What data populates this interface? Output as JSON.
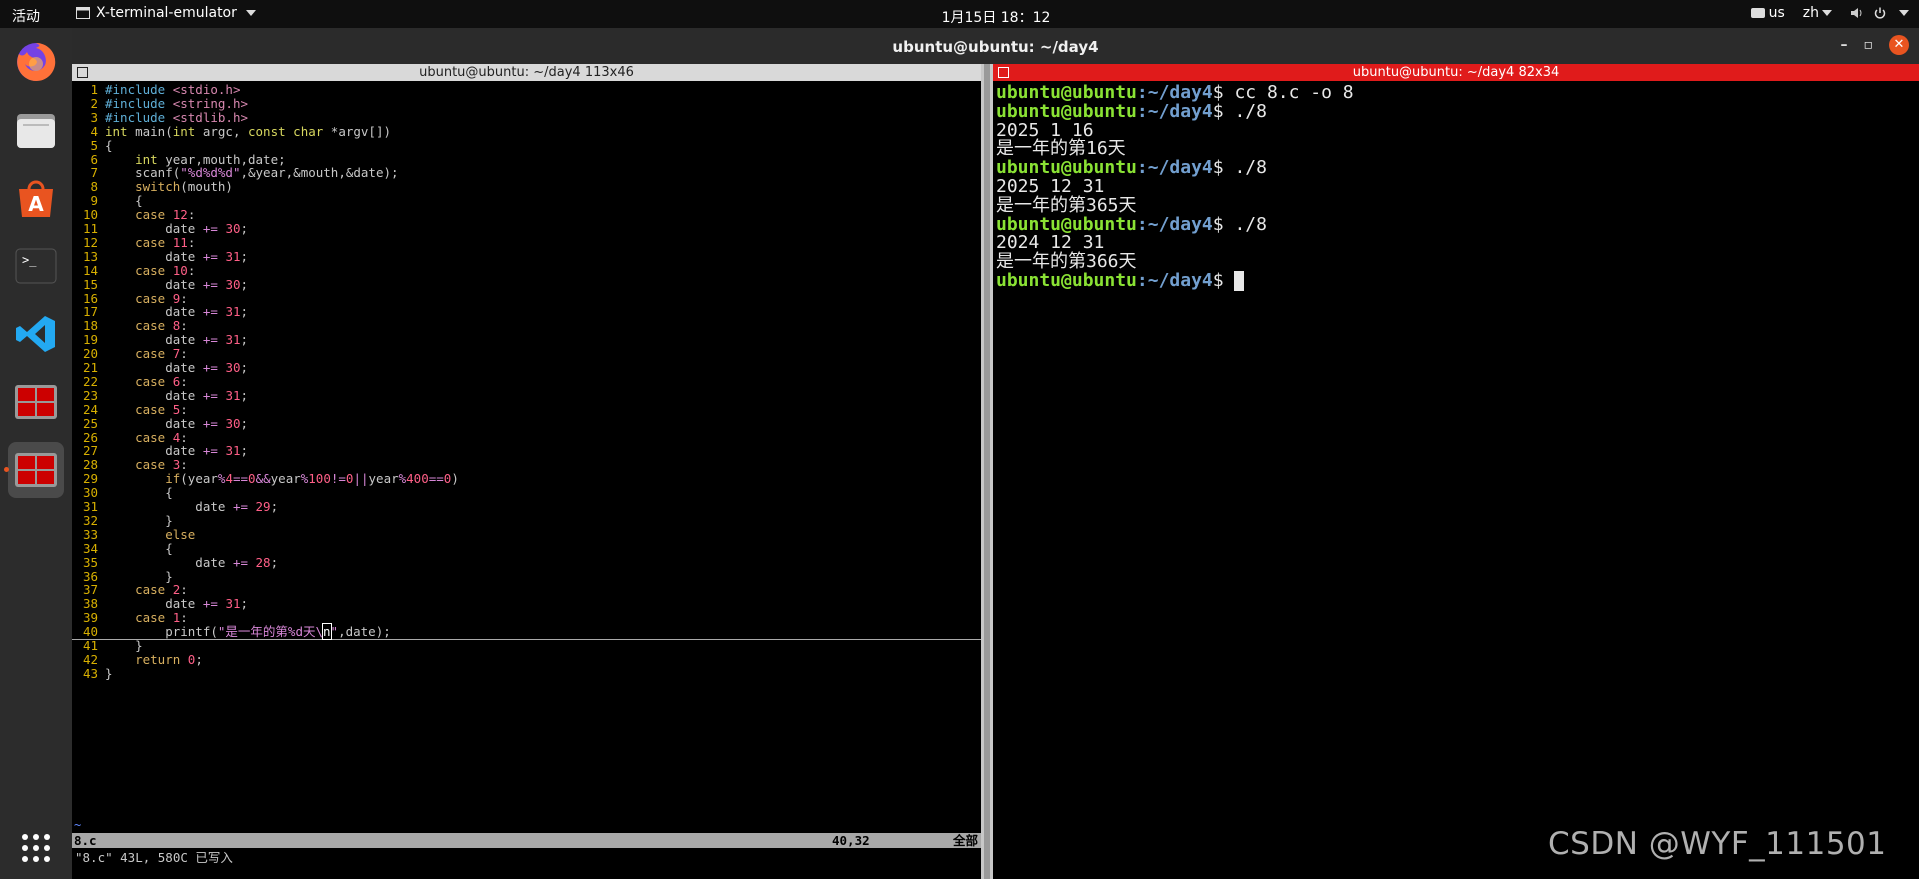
{
  "topbar": {
    "activities": "活动",
    "app_name": "X-terminal-emulator",
    "clock": "1月15日  18：12",
    "input_method": "us",
    "language": "zh"
  },
  "window": {
    "title": "ubuntu@ubuntu: ~/day4",
    "minimize": "–",
    "maximize": "▫",
    "close": "✕"
  },
  "dock": {
    "items": [
      "firefox",
      "files",
      "app-center",
      "terminal",
      "vscode",
      "terminator",
      "terminator-active"
    ]
  },
  "left_pane": {
    "title": "ubuntu@ubuntu: ~/day4 113x46",
    "lines": [
      {
        "n": "1",
        "parts": [
          [
            "#include ",
            "inc"
          ],
          [
            "<stdio.h>",
            "hdr"
          ]
        ]
      },
      {
        "n": "2",
        "parts": [
          [
            "#include ",
            "inc"
          ],
          [
            "<string.h>",
            "hdr"
          ]
        ]
      },
      {
        "n": "3",
        "parts": [
          [
            "#include ",
            "inc"
          ],
          [
            "<stdlib.h>",
            "hdr"
          ]
        ]
      },
      {
        "n": "4",
        "parts": [
          [
            "int",
            "type"
          ],
          [
            " main(",
            ""
          ],
          [
            "int",
            "type"
          ],
          [
            " argc, ",
            ""
          ],
          [
            "const",
            "type"
          ],
          [
            " ",
            ""
          ],
          [
            "char",
            "type"
          ],
          [
            " *argv[])",
            ""
          ]
        ]
      },
      {
        "n": "5",
        "parts": [
          [
            "{",
            ""
          ]
        ]
      },
      {
        "n": "6",
        "parts": [
          [
            "    ",
            ""
          ],
          [
            "int",
            "type"
          ],
          [
            " year,mouth,date;",
            ""
          ]
        ]
      },
      {
        "n": "7",
        "parts": [
          [
            "    scanf(",
            ""
          ],
          [
            "\"%d%d%d\"",
            "str"
          ],
          [
            ",&year,&mouth,&date);",
            ""
          ]
        ]
      },
      {
        "n": "8",
        "parts": [
          [
            "    ",
            ""
          ],
          [
            "switch",
            "kw"
          ],
          [
            "(mouth)",
            ""
          ]
        ]
      },
      {
        "n": "9",
        "parts": [
          [
            "    {",
            ""
          ]
        ]
      },
      {
        "n": "10",
        "parts": [
          [
            "    ",
            ""
          ],
          [
            "case",
            "kw"
          ],
          [
            " ",
            ""
          ],
          [
            "12",
            "num"
          ],
          [
            ":",
            ""
          ]
        ]
      },
      {
        "n": "11",
        "parts": [
          [
            "        date ",
            ""
          ],
          [
            "+=",
            "op"
          ],
          [
            " ",
            ""
          ],
          [
            "30",
            "num"
          ],
          [
            ";",
            ""
          ]
        ]
      },
      {
        "n": "12",
        "parts": [
          [
            "    ",
            ""
          ],
          [
            "case",
            "kw"
          ],
          [
            " ",
            ""
          ],
          [
            "11",
            "num"
          ],
          [
            ":",
            ""
          ]
        ]
      },
      {
        "n": "13",
        "parts": [
          [
            "        date ",
            ""
          ],
          [
            "+=",
            "op"
          ],
          [
            " ",
            ""
          ],
          [
            "31",
            "num"
          ],
          [
            ";",
            ""
          ]
        ]
      },
      {
        "n": "14",
        "parts": [
          [
            "    ",
            ""
          ],
          [
            "case",
            "kw"
          ],
          [
            " ",
            ""
          ],
          [
            "10",
            "num"
          ],
          [
            ":",
            ""
          ]
        ]
      },
      {
        "n": "15",
        "parts": [
          [
            "        date ",
            ""
          ],
          [
            "+=",
            "op"
          ],
          [
            " ",
            ""
          ],
          [
            "30",
            "num"
          ],
          [
            ";",
            ""
          ]
        ]
      },
      {
        "n": "16",
        "parts": [
          [
            "    ",
            ""
          ],
          [
            "case",
            "kw"
          ],
          [
            " ",
            ""
          ],
          [
            "9",
            "num"
          ],
          [
            ":",
            ""
          ]
        ]
      },
      {
        "n": "17",
        "parts": [
          [
            "        date ",
            ""
          ],
          [
            "+=",
            "op"
          ],
          [
            " ",
            ""
          ],
          [
            "31",
            "num"
          ],
          [
            ";",
            ""
          ]
        ]
      },
      {
        "n": "18",
        "parts": [
          [
            "    ",
            ""
          ],
          [
            "case",
            "kw"
          ],
          [
            " ",
            ""
          ],
          [
            "8",
            "num"
          ],
          [
            ":",
            ""
          ]
        ]
      },
      {
        "n": "19",
        "parts": [
          [
            "        date ",
            ""
          ],
          [
            "+=",
            "op"
          ],
          [
            " ",
            ""
          ],
          [
            "31",
            "num"
          ],
          [
            ";",
            ""
          ]
        ]
      },
      {
        "n": "20",
        "parts": [
          [
            "    ",
            ""
          ],
          [
            "case",
            "kw"
          ],
          [
            " ",
            ""
          ],
          [
            "7",
            "num"
          ],
          [
            ":",
            ""
          ]
        ]
      },
      {
        "n": "21",
        "parts": [
          [
            "        date ",
            ""
          ],
          [
            "+=",
            "op"
          ],
          [
            " ",
            ""
          ],
          [
            "30",
            "num"
          ],
          [
            ";",
            ""
          ]
        ]
      },
      {
        "n": "22",
        "parts": [
          [
            "    ",
            ""
          ],
          [
            "case",
            "kw"
          ],
          [
            " ",
            ""
          ],
          [
            "6",
            "num"
          ],
          [
            ":",
            ""
          ]
        ]
      },
      {
        "n": "23",
        "parts": [
          [
            "        date ",
            ""
          ],
          [
            "+=",
            "op"
          ],
          [
            " ",
            ""
          ],
          [
            "31",
            "num"
          ],
          [
            ";",
            ""
          ]
        ]
      },
      {
        "n": "24",
        "parts": [
          [
            "    ",
            ""
          ],
          [
            "case",
            "kw"
          ],
          [
            " ",
            ""
          ],
          [
            "5",
            "num"
          ],
          [
            ":",
            ""
          ]
        ]
      },
      {
        "n": "25",
        "parts": [
          [
            "        date ",
            ""
          ],
          [
            "+=",
            "op"
          ],
          [
            " ",
            ""
          ],
          [
            "30",
            "num"
          ],
          [
            ";",
            ""
          ]
        ]
      },
      {
        "n": "26",
        "parts": [
          [
            "    ",
            ""
          ],
          [
            "case",
            "kw"
          ],
          [
            " ",
            ""
          ],
          [
            "4",
            "num"
          ],
          [
            ":",
            ""
          ]
        ]
      },
      {
        "n": "27",
        "parts": [
          [
            "        date ",
            ""
          ],
          [
            "+=",
            "op"
          ],
          [
            " ",
            ""
          ],
          [
            "31",
            "num"
          ],
          [
            ";",
            ""
          ]
        ]
      },
      {
        "n": "28",
        "parts": [
          [
            "    ",
            ""
          ],
          [
            "case",
            "kw"
          ],
          [
            " ",
            ""
          ],
          [
            "3",
            "num"
          ],
          [
            ":",
            ""
          ]
        ]
      },
      {
        "n": "29",
        "parts": [
          [
            "        ",
            ""
          ],
          [
            "if",
            "kw"
          ],
          [
            "(year",
            ""
          ],
          [
            "%",
            "op"
          ],
          [
            "4",
            "num"
          ],
          [
            "==",
            "op"
          ],
          [
            "0",
            "num"
          ],
          [
            "&&",
            "op"
          ],
          [
            "year",
            ""
          ],
          [
            "%",
            "op"
          ],
          [
            "100",
            "num"
          ],
          [
            "!=",
            "op"
          ],
          [
            "0",
            "num"
          ],
          [
            "||",
            "op"
          ],
          [
            "year",
            ""
          ],
          [
            "%",
            "op"
          ],
          [
            "400",
            "num"
          ],
          [
            "==",
            "op"
          ],
          [
            "0",
            "num"
          ],
          [
            ")",
            ""
          ]
        ]
      },
      {
        "n": "30",
        "parts": [
          [
            "        {",
            ""
          ]
        ]
      },
      {
        "n": "31",
        "parts": [
          [
            "            date ",
            ""
          ],
          [
            "+=",
            "op"
          ],
          [
            " ",
            ""
          ],
          [
            "29",
            "num"
          ],
          [
            ";",
            ""
          ]
        ]
      },
      {
        "n": "32",
        "parts": [
          [
            "        }",
            ""
          ]
        ]
      },
      {
        "n": "33",
        "parts": [
          [
            "        ",
            ""
          ],
          [
            "else",
            "kw"
          ]
        ]
      },
      {
        "n": "34",
        "parts": [
          [
            "        {",
            ""
          ]
        ]
      },
      {
        "n": "35",
        "parts": [
          [
            "            date ",
            ""
          ],
          [
            "+=",
            "op"
          ],
          [
            " ",
            ""
          ],
          [
            "28",
            "num"
          ],
          [
            ";",
            ""
          ]
        ]
      },
      {
        "n": "36",
        "parts": [
          [
            "        }",
            ""
          ]
        ]
      },
      {
        "n": "37",
        "parts": [
          [
            "    ",
            ""
          ],
          [
            "case",
            "kw"
          ],
          [
            " ",
            ""
          ],
          [
            "2",
            "num"
          ],
          [
            ":",
            ""
          ]
        ]
      },
      {
        "n": "38",
        "parts": [
          [
            "        date ",
            ""
          ],
          [
            "+=",
            "op"
          ],
          [
            " ",
            ""
          ],
          [
            "31",
            "num"
          ],
          [
            ";",
            ""
          ]
        ]
      },
      {
        "n": "39",
        "parts": [
          [
            "    ",
            ""
          ],
          [
            "case",
            "kw"
          ],
          [
            " ",
            ""
          ],
          [
            "1",
            "num"
          ],
          [
            ":",
            ""
          ]
        ]
      },
      {
        "n": "40",
        "parts": [
          [
            "        printf(",
            ""
          ],
          [
            "\"是一年的第%d天\\",
            "str"
          ],
          [
            "n",
            "cur"
          ],
          [
            "\"",
            "str"
          ],
          [
            ",date);",
            ""
          ]
        ],
        "cursorline": true
      },
      {
        "n": "41",
        "parts": [
          [
            "    }",
            ""
          ]
        ]
      },
      {
        "n": "42",
        "parts": [
          [
            "    ",
            ""
          ],
          [
            "return",
            "kw"
          ],
          [
            " ",
            ""
          ],
          [
            "0",
            "num"
          ],
          [
            ";",
            ""
          ]
        ]
      },
      {
        "n": "43",
        "parts": [
          [
            "}",
            ""
          ]
        ]
      }
    ],
    "tilde": "~",
    "status": {
      "filename": "8.c",
      "position": "40,32",
      "percent": "全部"
    },
    "message": "\"8.c\" 43L, 580C 已写入"
  },
  "right_pane": {
    "title": "ubuntu@ubuntu: ~/day4 82x34",
    "prompt_user": "ubuntu@ubuntu",
    "prompt_path": ":~/day4",
    "prompt_end": "$ ",
    "lines": [
      {
        "type": "cmd",
        "text": "cc 8.c -o 8"
      },
      {
        "type": "cmd",
        "text": "./8"
      },
      {
        "type": "out",
        "text": "2025 1 16"
      },
      {
        "type": "out",
        "text": "是一年的第16天"
      },
      {
        "type": "cmd",
        "text": "./8"
      },
      {
        "type": "out",
        "text": "2025 12 31"
      },
      {
        "type": "out",
        "text": "是一年的第365天"
      },
      {
        "type": "cmd",
        "text": "./8"
      },
      {
        "type": "out",
        "text": "2024 12 31"
      },
      {
        "type": "out",
        "text": "是一年的第366天"
      },
      {
        "type": "prompt",
        "text": ""
      }
    ]
  },
  "watermark": "CSDN @WYF_111501",
  "colors": {
    "accent": "#e95420",
    "focused_title": "#e01b1b",
    "prompt_user": "#8ae234",
    "prompt_path": "#729fcf"
  }
}
